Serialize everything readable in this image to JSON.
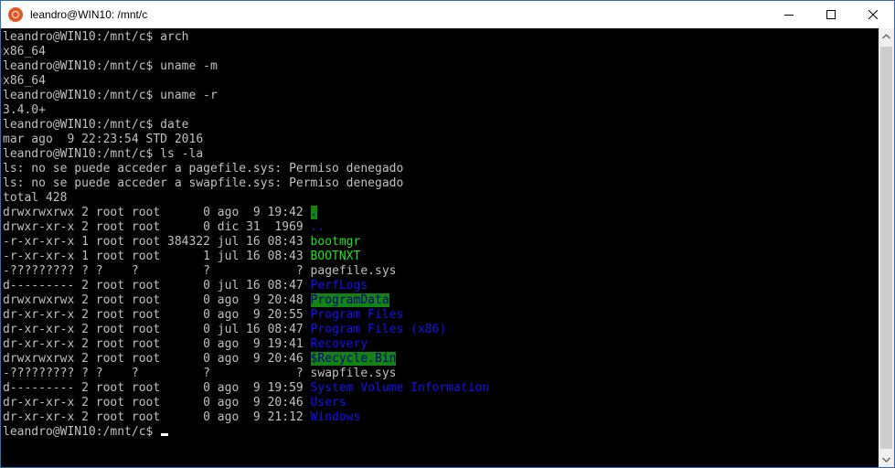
{
  "window": {
    "title": "leandro@WIN10: /mnt/c",
    "controls": {
      "minimize": "minimize-icon",
      "maximize": "maximize-icon",
      "close": "close-icon"
    }
  },
  "terminal": {
    "colors": {
      "background": "#000000",
      "text": "#c0c0c0",
      "blue": "#1313ee",
      "green": "#25dd25",
      "highlight_bg": "#128412"
    },
    "lines": [
      {
        "segments": [
          {
            "text": "leandro@WIN10:/mnt/c$ arch",
            "style": "plain"
          }
        ]
      },
      {
        "segments": [
          {
            "text": "x86_64",
            "style": "plain"
          }
        ]
      },
      {
        "segments": [
          {
            "text": "leandro@WIN10:/mnt/c$ uname -m",
            "style": "plain"
          }
        ]
      },
      {
        "segments": [
          {
            "text": "x86_64",
            "style": "plain"
          }
        ]
      },
      {
        "segments": [
          {
            "text": "leandro@WIN10:/mnt/c$ uname -r",
            "style": "plain"
          }
        ]
      },
      {
        "segments": [
          {
            "text": "3.4.0+",
            "style": "plain"
          }
        ]
      },
      {
        "segments": [
          {
            "text": "leandro@WIN10:/mnt/c$ date",
            "style": "plain"
          }
        ]
      },
      {
        "segments": [
          {
            "text": "mar ago  9 22:23:54 STD 2016",
            "style": "plain"
          }
        ]
      },
      {
        "segments": [
          {
            "text": "leandro@WIN10:/mnt/c$ ls -la",
            "style": "plain"
          }
        ]
      },
      {
        "segments": [
          {
            "text": "ls: no se puede acceder a pagefile.sys: Permiso denegado",
            "style": "plain"
          }
        ]
      },
      {
        "segments": [
          {
            "text": "ls: no se puede acceder a swapfile.sys: Permiso denegado",
            "style": "plain"
          }
        ]
      },
      {
        "segments": [
          {
            "text": "total 428",
            "style": "plain"
          }
        ]
      },
      {
        "segments": [
          {
            "text": "drwxrwxrwx 2 root root      0 ago  9 19:42 ",
            "style": "plain"
          },
          {
            "text": ".",
            "style": "hl"
          }
        ]
      },
      {
        "segments": [
          {
            "text": "drwxr-xr-x 2 root root      0 dic 31  1969 ",
            "style": "plain"
          },
          {
            "text": "..",
            "style": "blue"
          }
        ]
      },
      {
        "segments": [
          {
            "text": "-r-xr-xr-x 1 root root 384322 jul 16 08:43 ",
            "style": "plain"
          },
          {
            "text": "bootmgr",
            "style": "green"
          }
        ]
      },
      {
        "segments": [
          {
            "text": "-r-xr-xr-x 1 root root      1 jul 16 08:43 ",
            "style": "plain"
          },
          {
            "text": "BOOTNXT",
            "style": "green"
          }
        ]
      },
      {
        "segments": [
          {
            "text": "-????????? ? ?    ?         ?            ? pagefile.sys",
            "style": "plain"
          }
        ]
      },
      {
        "segments": [
          {
            "text": "d--------- 2 root root      0 jul 16 08:47 ",
            "style": "plain"
          },
          {
            "text": "PerfLogs",
            "style": "blue"
          }
        ]
      },
      {
        "segments": [
          {
            "text": "drwxrwxrwx 2 root root      0 ago  9 20:48 ",
            "style": "plain"
          },
          {
            "text": "ProgramData",
            "style": "hl"
          }
        ]
      },
      {
        "segments": [
          {
            "text": "dr-xr-xr-x 2 root root      0 ago  9 20:55 ",
            "style": "plain"
          },
          {
            "text": "Program Files",
            "style": "blue"
          }
        ]
      },
      {
        "segments": [
          {
            "text": "dr-xr-xr-x 2 root root      0 jul 16 08:47 ",
            "style": "plain"
          },
          {
            "text": "Program Files (x86)",
            "style": "blue"
          }
        ]
      },
      {
        "segments": [
          {
            "text": "dr-xr-xr-x 2 root root      0 ago  9 19:41 ",
            "style": "plain"
          },
          {
            "text": "Recovery",
            "style": "blue"
          }
        ]
      },
      {
        "segments": [
          {
            "text": "drwxrwxrwx 2 root root      0 ago  9 20:46 ",
            "style": "plain"
          },
          {
            "text": "$Recycle.Bin",
            "style": "hl"
          }
        ]
      },
      {
        "segments": [
          {
            "text": "-????????? ? ?    ?         ?            ? swapfile.sys",
            "style": "plain"
          }
        ]
      },
      {
        "segments": [
          {
            "text": "d--------- 2 root root      0 ago  9 19:59 ",
            "style": "plain"
          },
          {
            "text": "System Volume Information",
            "style": "blue"
          }
        ]
      },
      {
        "segments": [
          {
            "text": "dr-xr-xr-x 2 root root      0 ago  9 20:46 ",
            "style": "plain"
          },
          {
            "text": "Users",
            "style": "blue"
          }
        ]
      },
      {
        "segments": [
          {
            "text": "dr-xr-xr-x 2 root root      0 ago  9 21:12 ",
            "style": "plain"
          },
          {
            "text": "Windows",
            "style": "blue"
          }
        ]
      },
      {
        "segments": [
          {
            "text": "leandro@WIN10:/mnt/c$ ",
            "style": "plain"
          }
        ],
        "cursor": true
      }
    ]
  }
}
